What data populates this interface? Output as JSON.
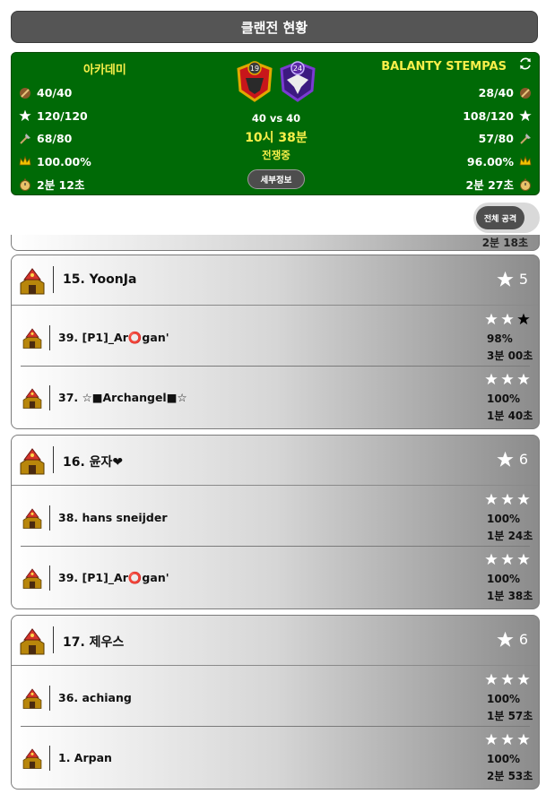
{
  "header": {
    "title": "클랜전 현황"
  },
  "war": {
    "clan_left": {
      "name": "아카데미",
      "level": "19",
      "attacks": "40/40",
      "stars": "120/120",
      "destruction_attacks": "68/80",
      "percent": "100.00%",
      "avg_time": "2분 12초"
    },
    "clan_right": {
      "name": "BALANTY STEMPAS",
      "level": "24",
      "attacks": "28/40",
      "stars": "108/120",
      "destruction_attacks": "57/80",
      "percent": "96.00%",
      "avg_time": "2분 27초"
    },
    "vs": "40 vs 40",
    "time_remaining": "10시 38분",
    "status": "전쟁중",
    "details_button": "세부정보"
  },
  "toggle": {
    "label": "전체 공격"
  },
  "peek": {
    "time": "2분 18초"
  },
  "cards": [
    {
      "player": "15. YoonJa",
      "stars": "5",
      "attacks": [
        {
          "target": "39. [P1]_Ar⭕gan'",
          "stars": [
            1,
            1,
            0
          ],
          "percent": "98%",
          "time": "3분 00초"
        },
        {
          "target": "37. ☆■Archangel■☆",
          "stars": [
            1,
            1,
            1
          ],
          "percent": "100%",
          "time": "1분 40초"
        }
      ]
    },
    {
      "player": "16. 윤자❤",
      "stars": "6",
      "attacks": [
        {
          "target": "38. hans sneijder",
          "stars": [
            1,
            1,
            1
          ],
          "percent": "100%",
          "time": "1분 24초"
        },
        {
          "target": "39. [P1]_Ar⭕gan'",
          "stars": [
            1,
            1,
            1
          ],
          "percent": "100%",
          "time": "1분 38초"
        }
      ]
    },
    {
      "player": "17. 제우스",
      "stars": "6",
      "attacks": [
        {
          "target": "36. achiang",
          "stars": [
            1,
            1,
            1
          ],
          "percent": "100%",
          "time": "1분 57초"
        },
        {
          "target": "1. Arpan",
          "stars": [
            1,
            1,
            1
          ],
          "percent": "100%",
          "time": "2분 53초"
        }
      ]
    }
  ],
  "colors": {
    "panel_green": "#006a06",
    "gold_text": "#f8ef4a",
    "title_bar": "#555555",
    "star_earned": "#ffffff",
    "star_missed": "#000000"
  },
  "icons": {
    "attacks": "sword-icon",
    "stars": "star-icon",
    "destruction": "axe-icon",
    "percent": "crown-icon",
    "time": "stopwatch-icon",
    "refresh": "refresh-icon",
    "town_hall": "town-hall-icon"
  }
}
